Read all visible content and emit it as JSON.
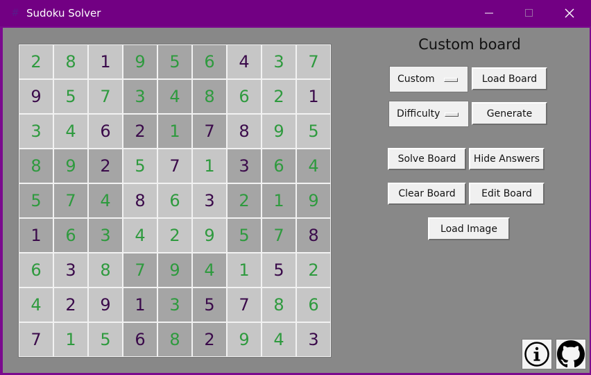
{
  "window": {
    "title": "Sudoku Solver",
    "app_icon": "#"
  },
  "panel": {
    "title": "Custom board"
  },
  "controls": {
    "board_dropdown": "Custom",
    "load_board": "Load Board",
    "difficulty_dropdown": "Difficulty",
    "generate": "Generate",
    "solve_board": "Solve Board",
    "hide_answers": "Hide Answers",
    "clear_board": "Clear Board",
    "edit_board": "Edit Board",
    "load_image": "Load Image"
  },
  "colors": {
    "given": "#3a0a4a",
    "solved": "#2e9a3e",
    "titlebar": "#720083"
  },
  "board": {
    "values": [
      [
        2,
        8,
        1,
        9,
        5,
        6,
        4,
        3,
        7
      ],
      [
        9,
        5,
        7,
        3,
        4,
        8,
        6,
        2,
        1
      ],
      [
        3,
        4,
        6,
        2,
        1,
        7,
        8,
        9,
        5
      ],
      [
        8,
        9,
        2,
        5,
        7,
        1,
        3,
        6,
        4
      ],
      [
        5,
        7,
        4,
        8,
        6,
        3,
        2,
        1,
        9
      ],
      [
        1,
        6,
        3,
        4,
        2,
        9,
        5,
        7,
        8
      ],
      [
        6,
        3,
        8,
        7,
        9,
        4,
        1,
        5,
        2
      ],
      [
        4,
        2,
        9,
        1,
        3,
        5,
        7,
        8,
        6
      ],
      [
        7,
        1,
        5,
        6,
        8,
        2,
        9,
        4,
        3
      ]
    ],
    "given": [
      [
        0,
        0,
        1,
        0,
        0,
        0,
        1,
        0,
        0
      ],
      [
        1,
        0,
        0,
        0,
        0,
        0,
        0,
        0,
        1
      ],
      [
        0,
        0,
        1,
        1,
        0,
        1,
        1,
        0,
        0
      ],
      [
        0,
        0,
        1,
        0,
        1,
        0,
        1,
        0,
        0
      ],
      [
        0,
        0,
        0,
        1,
        0,
        1,
        0,
        0,
        0
      ],
      [
        1,
        0,
        0,
        0,
        0,
        0,
        0,
        0,
        1
      ],
      [
        0,
        1,
        0,
        0,
        0,
        0,
        0,
        1,
        0
      ],
      [
        0,
        1,
        1,
        1,
        0,
        1,
        1,
        0,
        0
      ],
      [
        1,
        0,
        0,
        1,
        0,
        1,
        0,
        0,
        1
      ]
    ]
  },
  "icons": {
    "info": "info-icon",
    "github": "github-icon"
  }
}
